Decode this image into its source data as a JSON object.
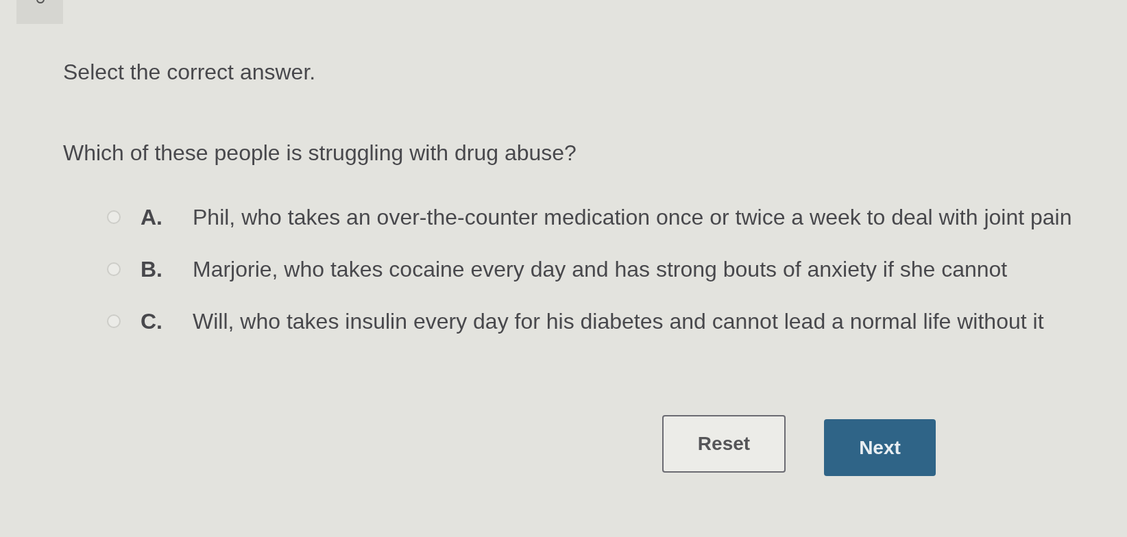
{
  "instruction": "Select the correct answer.",
  "question": "Which of these people is struggling with drug abuse?",
  "options": [
    {
      "letter": "A.",
      "text": "Phil, who takes an over-the-counter medication once or twice a week to deal with joint pain",
      "selected": false
    },
    {
      "letter": "B.",
      "text": "Marjorie, who takes cocaine every day and has strong bouts of anxiety if she cannot",
      "selected": false
    },
    {
      "letter": "C.",
      "text": "Will, who takes insulin every day for his diabetes and cannot lead a normal life without it",
      "selected": false
    }
  ],
  "buttons": [
    {
      "kind": "secondary",
      "label": "Reset"
    },
    {
      "kind": "primary",
      "label": "Next"
    }
  ]
}
